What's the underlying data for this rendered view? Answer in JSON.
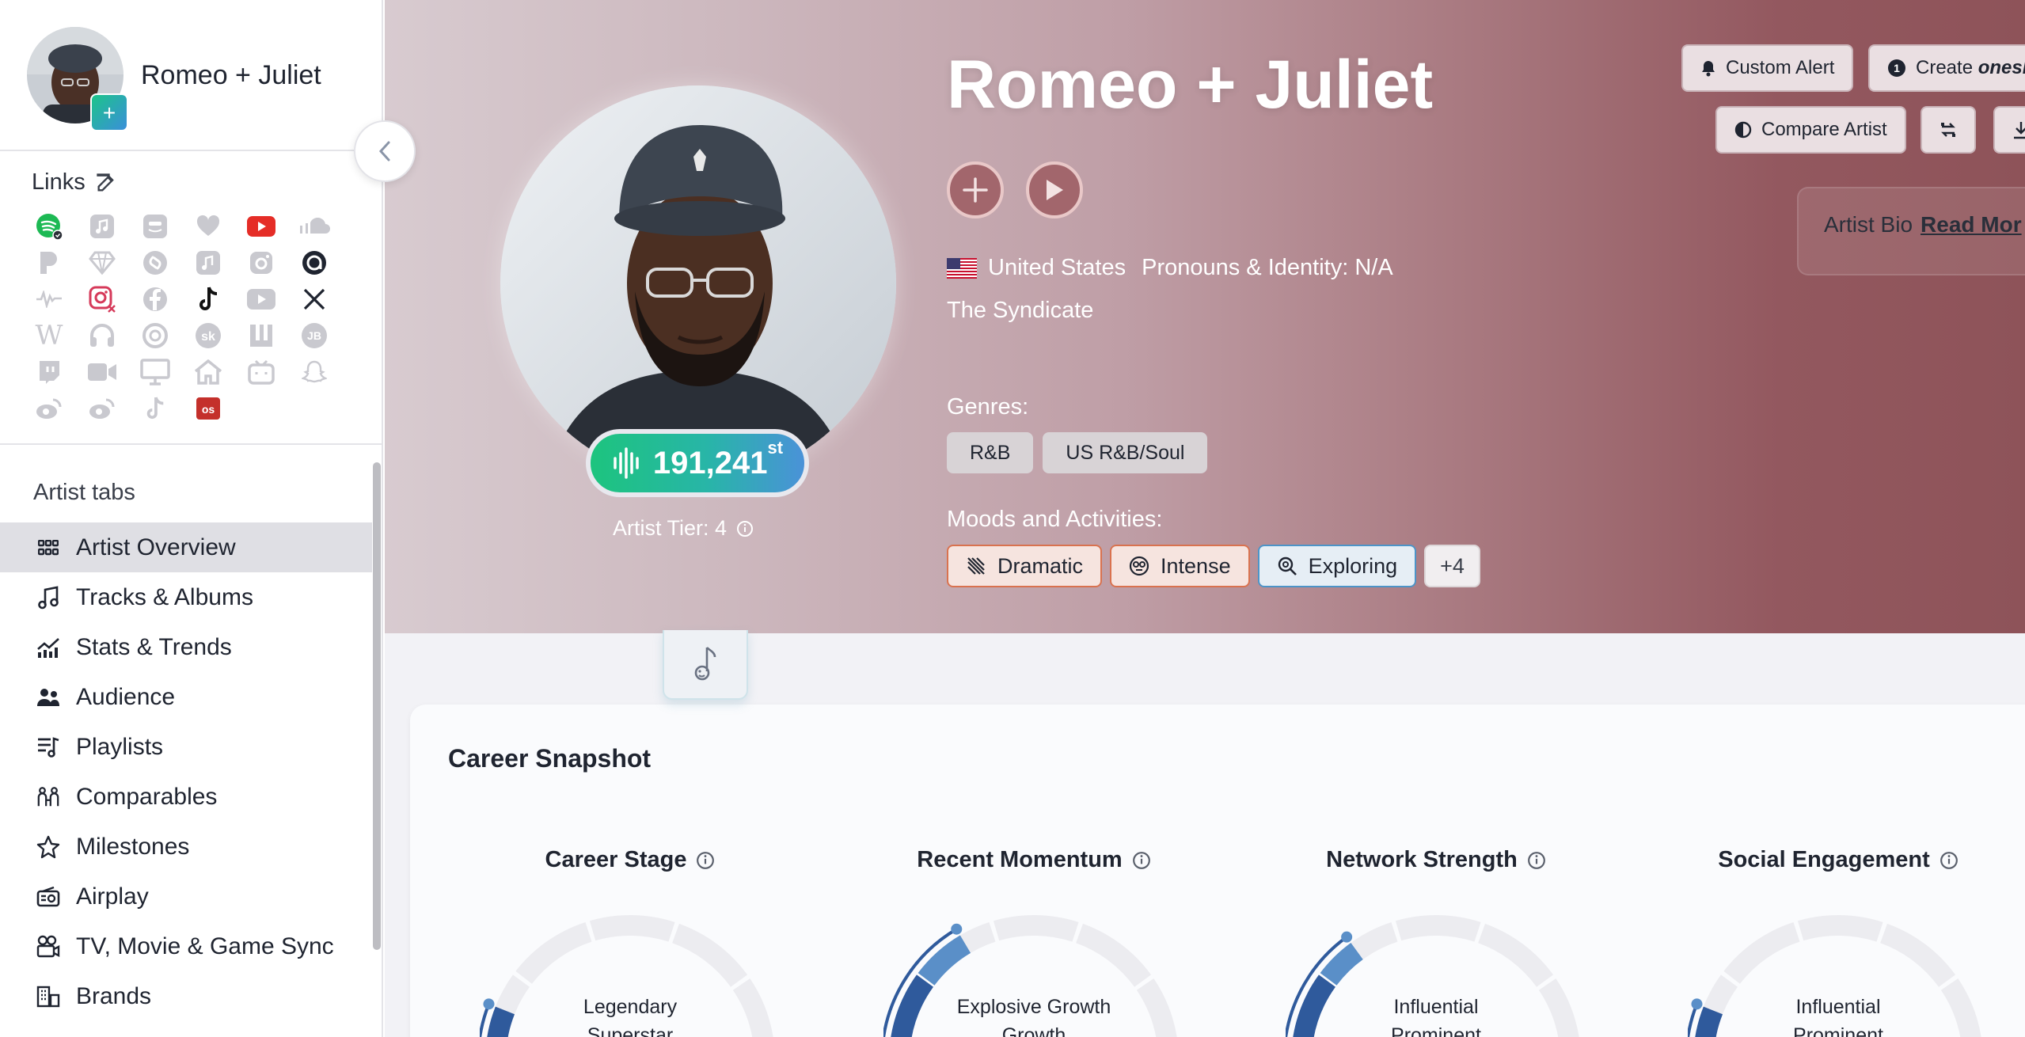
{
  "sidebar": {
    "artist_name": "Romeo + Juliet",
    "add_label": "+",
    "links_title": "Links",
    "tabs_title": "Artist tabs",
    "tabs": [
      {
        "label": "Artist Overview",
        "icon": "grid-icon",
        "active": true
      },
      {
        "label": "Tracks & Albums",
        "icon": "music-note-icon"
      },
      {
        "label": "Stats & Trends",
        "icon": "stats-chart-icon"
      },
      {
        "label": "Audience",
        "icon": "people-icon"
      },
      {
        "label": "Playlists",
        "icon": "playlist-icon"
      },
      {
        "label": "Comparables",
        "icon": "compare-people-icon"
      },
      {
        "label": "Milestones",
        "icon": "star-icon"
      },
      {
        "label": "Airplay",
        "icon": "radio-icon"
      },
      {
        "label": "TV, Movie & Game Sync",
        "icon": "film-icon"
      },
      {
        "label": "Brands",
        "icon": "brands-icon"
      }
    ]
  },
  "hero": {
    "title": "Romeo + Juliet",
    "country": "United States",
    "pronouns": "Pronouns & Identity: N/A",
    "label": "The Syndicate",
    "rank": "191,241",
    "rank_suffix": "st",
    "tier": "Artist Tier: 4",
    "genres_label": "Genres:",
    "genres": [
      "R&B",
      "US R&B/Soul"
    ],
    "moods_label": "Moods and Activities:",
    "moods": [
      "Dramatic",
      "Intense",
      "Exploring"
    ],
    "moods_more": "+4",
    "buttons": {
      "custom_alert": "Custom Alert",
      "create": "Create ",
      "create_bold": "onesh",
      "compare": "Compare Artist"
    },
    "bio_label": "Artist Bio",
    "bio_link": "Read Mor"
  },
  "snapshot": {
    "title": "Career Snapshot",
    "metrics": [
      {
        "title": "Career Stage",
        "label1": "Legendary",
        "label2": "Superstar",
        "level": 0.12
      },
      {
        "title": "Recent Momentum",
        "label1": "Explosive Growth",
        "label2": "Growth",
        "level": 0.33
      },
      {
        "title": "Network Strength",
        "label1": "Influential",
        "label2": "Prominent",
        "level": 0.3
      },
      {
        "title": "Social Engagement",
        "label1": "Influential",
        "label2": "Prominent",
        "level": 0.12
      }
    ]
  },
  "colors": {
    "accent_green": "#1dc47e",
    "accent_blue": "#4a92d8",
    "gauge_dark": "#2f5a9c",
    "gauge_light": "#5a8fc8",
    "hero_dark": "#8e5359"
  }
}
